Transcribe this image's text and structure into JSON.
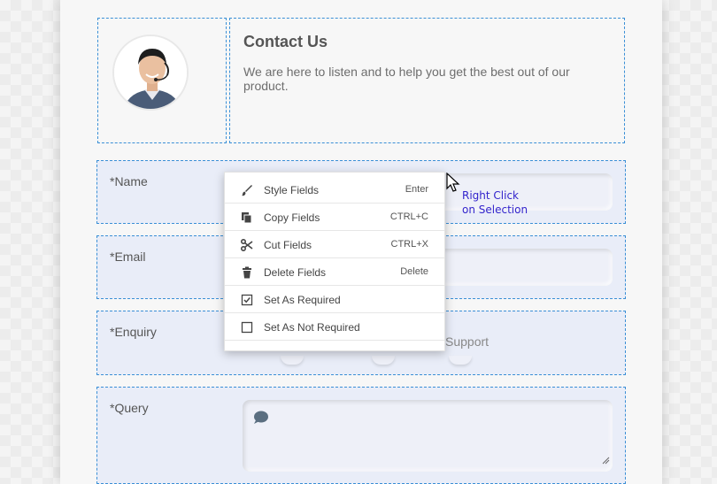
{
  "contact": {
    "title": "Contact Us",
    "description": "We are here to listen and to help you get the best out of our product."
  },
  "form": {
    "name_label": "*Name",
    "email_label": "*Email",
    "enquiry_label": "*Enquiry",
    "enquiry_visible_option": "Support",
    "query_label": "*Query"
  },
  "context_menu": {
    "items": [
      {
        "label": "Style Fields",
        "shortcut": "Enter",
        "icon": "paintbrush-icon"
      },
      {
        "label": "Copy Fields",
        "shortcut": "CTRL+C",
        "icon": "copy-icon"
      },
      {
        "label": "Cut Fields",
        "shortcut": "CTRL+X",
        "icon": "scissors-icon"
      },
      {
        "label": "Delete Fields",
        "shortcut": "Delete",
        "icon": "trash-icon"
      },
      {
        "label": "Set As Required",
        "shortcut": "",
        "icon": "checked-box-icon"
      },
      {
        "label": "Set As Not Required",
        "shortcut": "",
        "icon": "empty-box-icon"
      }
    ]
  },
  "annotation": {
    "line1": "Right Click",
    "line2": "on Selection"
  },
  "colors": {
    "selection_border": "#3a8fd6",
    "row_background": "#e9edf8",
    "annotation_text": "#3324cc"
  }
}
